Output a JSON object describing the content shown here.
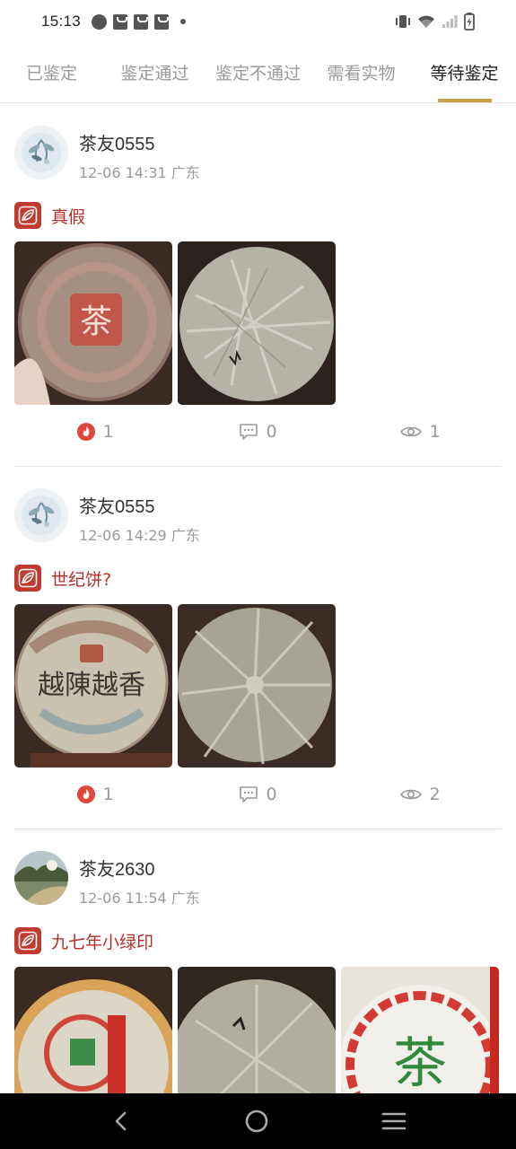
{
  "status_bar": {
    "time": "15:13",
    "icons": [
      "speedometer-icon",
      "bag-icon",
      "bag-icon",
      "bag-icon",
      "dot-icon",
      "vibrate-icon",
      "wifi-icon",
      "signal-icon",
      "battery-charging-icon"
    ]
  },
  "tabs": [
    {
      "label": "已鉴定",
      "active": false
    },
    {
      "label": "鉴定通过",
      "active": false
    },
    {
      "label": "鉴定不通过",
      "active": false
    },
    {
      "label": "需看实物",
      "active": false
    },
    {
      "label": "等待鉴定",
      "active": true
    }
  ],
  "posts": [
    {
      "username": "茶友0555",
      "time": "12-06 14:31",
      "location": "广东",
      "title": "真假",
      "likes": "1",
      "comments": "0",
      "views": "1"
    },
    {
      "username": "茶友0555",
      "time": "12-06 14:29",
      "location": "广东",
      "title": "世纪饼?",
      "likes": "1",
      "comments": "0",
      "views": "2"
    },
    {
      "username": "茶友2630",
      "time": "12-06 11:54",
      "location": "广东",
      "title": "九七年小绿印"
    }
  ],
  "image_text": {
    "p1_stamp": "茶",
    "p2_banner": "越陳越香",
    "p3_stamp": "茶"
  },
  "colors": {
    "accent_gold": "#c9a04a",
    "title_red": "#b0302b",
    "badge_red": "#c23b2f",
    "fire_red": "#e0473c"
  },
  "nav_bar": {
    "icons": [
      "back-icon",
      "home-icon",
      "menu-icon"
    ]
  }
}
